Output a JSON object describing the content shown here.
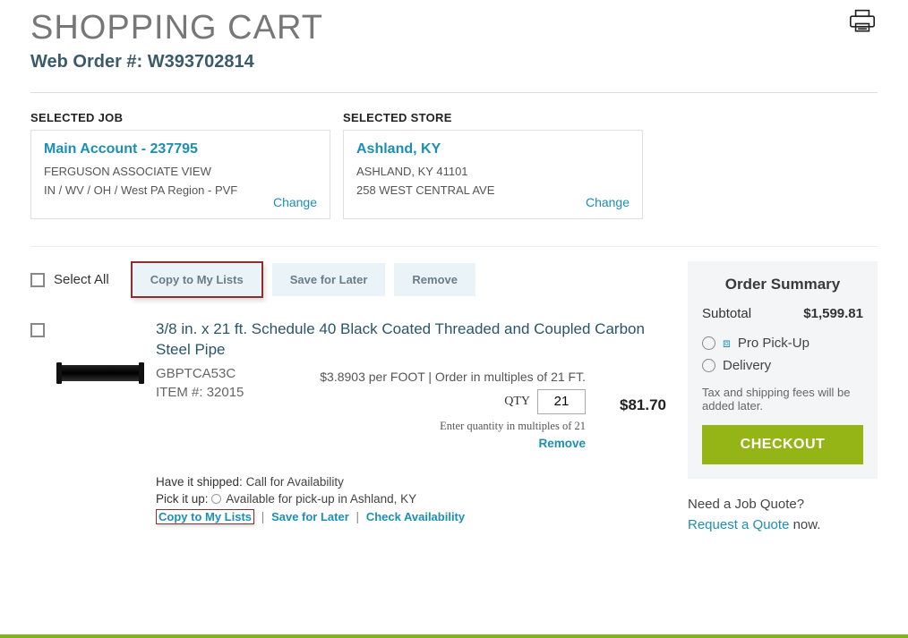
{
  "header": {
    "title": "SHOPPING CART",
    "orderPrefix": "Web Order #: ",
    "orderNumber": "W393702814"
  },
  "selectedJob": {
    "label": "SELECTED JOB",
    "title": "Main Account - 237795",
    "line1": "FERGUSON ASSOCIATE VIEW",
    "line2": "IN / WV / OH / West PA Region - PVF",
    "change": "Change"
  },
  "selectedStore": {
    "label": "SELECTED STORE",
    "title": "Ashland, KY",
    "line1": "ASHLAND, KY 41101",
    "line2": "258 WEST CENTRAL AVE",
    "change": "Change"
  },
  "actions": {
    "selectAll": "Select All",
    "copy": "Copy to My Lists",
    "save": "Save for Later",
    "remove": "Remove"
  },
  "item": {
    "title": "3/8 in. x 21 ft. Schedule 40 Black Coated Threaded and Coupled Carbon Steel Pipe",
    "code": "GBPTCA53C",
    "itemNumLabel": "ITEM #: ",
    "itemNum": "32015",
    "perFoot": "$3.8903 per FOOT | Order in multiples of 21 FT.",
    "qtyLabel": "QTY",
    "qty": "21",
    "qtyNote": "Enter quantity in multiples of 21",
    "removeLink": "Remove",
    "lineTotal": "$81.70",
    "shipLabel": "Have it shipped: ",
    "shipValue": "Call for Availability",
    "pickupLabel": "Pick it up: ",
    "pickupValue": "Available for pick-up in Ashland, KY",
    "copyLink": "Copy to My Lists",
    "saveLink": "Save for Later",
    "checkLink": "Check Availability"
  },
  "summary": {
    "title": "Order Summary",
    "subtotalLabel": "Subtotal",
    "subtotal": "$1,599.81",
    "proPickup": "Pro Pick-Up",
    "delivery": "Delivery",
    "taxNote": "Tax and shipping fees will be added later.",
    "checkout": "CHECKOUT",
    "quoteQ": "Need a Job Quote?",
    "quoteLink": "Request a Quote",
    "quoteSuffix": " now."
  }
}
